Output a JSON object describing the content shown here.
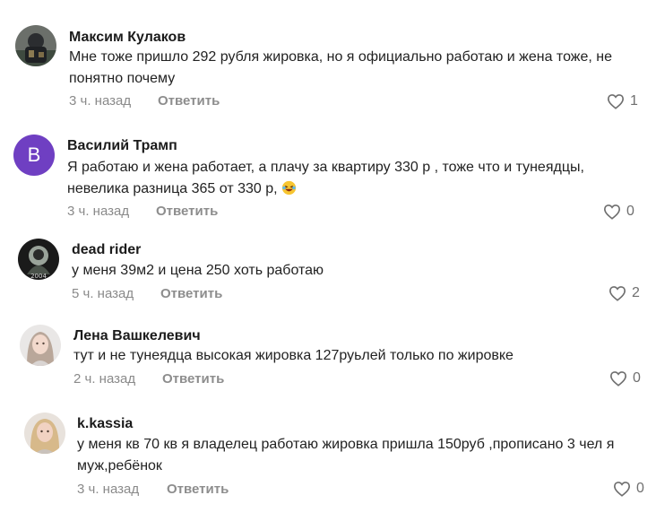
{
  "comments": [
    {
      "author": "Максим Кулаков",
      "text": "Мне тоже пришло 292 рубля жировка, но я официально работаю и жена тоже, не понятно почему",
      "time": "3 ч. назад",
      "reply_label": "Ответить",
      "likes": "1"
    },
    {
      "author": "Василий Трамп",
      "avatar_letter": "В",
      "text": "Я работаю и жена работает, а плачу за квартиру 330 р , тоже что и тунеядцы, невелика разница 365 от 330 р,",
      "time": "3 ч. назад",
      "reply_label": "Ответить",
      "likes": "0"
    },
    {
      "author": "dead rider",
      "avatar_caption": "2004",
      "text": "у меня 39м2 и цена 250 хоть работаю",
      "time": "5 ч. назад",
      "reply_label": "Ответить",
      "likes": "2"
    },
    {
      "author": "Лена Вашкелевич",
      "text": "тут и не тунеядца высокая жировка 127руьлей только по жировке",
      "time": "2 ч. назад",
      "reply_label": "Ответить",
      "likes": "0"
    },
    {
      "author": "k.kassia",
      "text": "у меня кв 70 кв я владелец работаю жировка пришла 150руб ,прописано 3 чел я муж,ребёнок",
      "time": "3 ч. назад",
      "reply_label": "Ответить",
      "likes": "0"
    }
  ],
  "colors": {
    "avatar_letter_bg": "#6f3fc2",
    "meta_text": "#8a8a8a",
    "like_icon": "#6f6f6f"
  },
  "icons": {
    "like": "heart-outline-icon",
    "emoji": "laughing-emoji-icon"
  }
}
